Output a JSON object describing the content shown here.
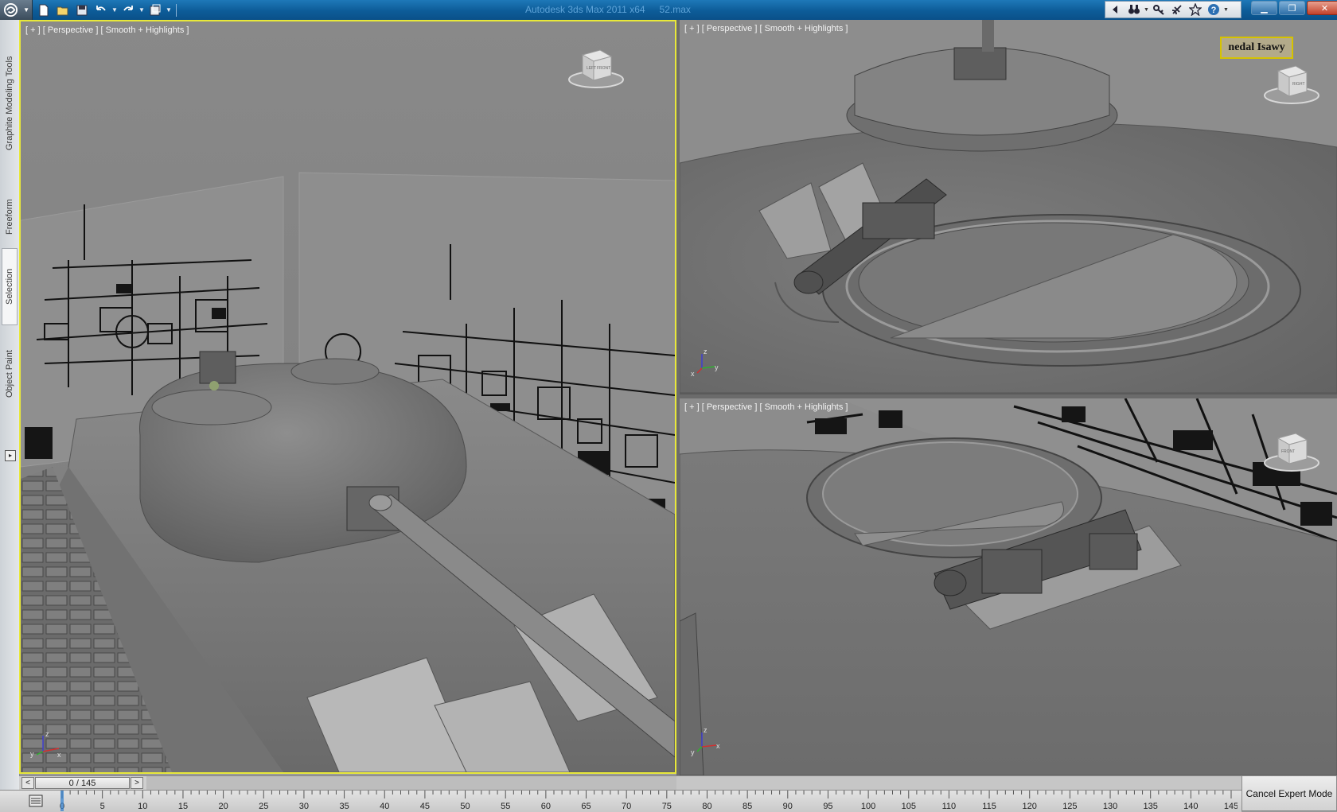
{
  "titlebar": {
    "app": "Autodesk 3ds Max  2011 x64",
    "file": "52.max",
    "quick_access": [
      "new-icon",
      "open-icon",
      "save-icon",
      "undo-icon",
      "redo-icon",
      "project-folder-icon"
    ],
    "infocenter": [
      "arrow-left-icon",
      "binoculars-icon",
      "key-icon",
      "satellite-icon",
      "star-icon",
      "help-icon"
    ],
    "controls": [
      "minimize",
      "restore",
      "close"
    ]
  },
  "ribbon": {
    "tabs": [
      {
        "label": "Graphite Modeling Tools",
        "active": false
      },
      {
        "label": "Freeform",
        "active": false
      },
      {
        "label": "Selection",
        "active": true
      },
      {
        "label": "Object Paint",
        "active": false
      }
    ]
  },
  "viewports": {
    "left": {
      "label": "[ + ] [ Perspective ] [ Smooth + Highlights ]",
      "active": true,
      "cube_text": [
        "LEFT",
        "FRONT"
      ]
    },
    "top_right": {
      "label": "[ + ] [ Perspective ] [ Smooth + Highlights ]",
      "active": false,
      "cube_text": [
        "RIGHT"
      ],
      "name_label": "nedal Isawy"
    },
    "bottom_right": {
      "label": "[ + ] [ Perspective ] [ Smooth + Highlights ]",
      "active": false,
      "cube_text": [
        "FRONT"
      ]
    }
  },
  "axis": {
    "x": "x",
    "y": "y",
    "z": "z"
  },
  "timeslider": {
    "value": "0 / 145",
    "current": 0,
    "total": 145,
    "prev": "<",
    "next": ">"
  },
  "trackbar": {
    "ticks": [
      0,
      5,
      10,
      15,
      20,
      25,
      30,
      35,
      40,
      45,
      50,
      55,
      60,
      65,
      70,
      75,
      80,
      85,
      90,
      95,
      100,
      105,
      110,
      115,
      120,
      125,
      130,
      135,
      140,
      145
    ]
  },
  "status": {
    "cancel_expert": "Cancel Expert Mode"
  },
  "colors": {
    "active_viewport": "#e8e83a",
    "titlebar": "#0d5c98",
    "viewport_bg": "#8c8c8c"
  }
}
